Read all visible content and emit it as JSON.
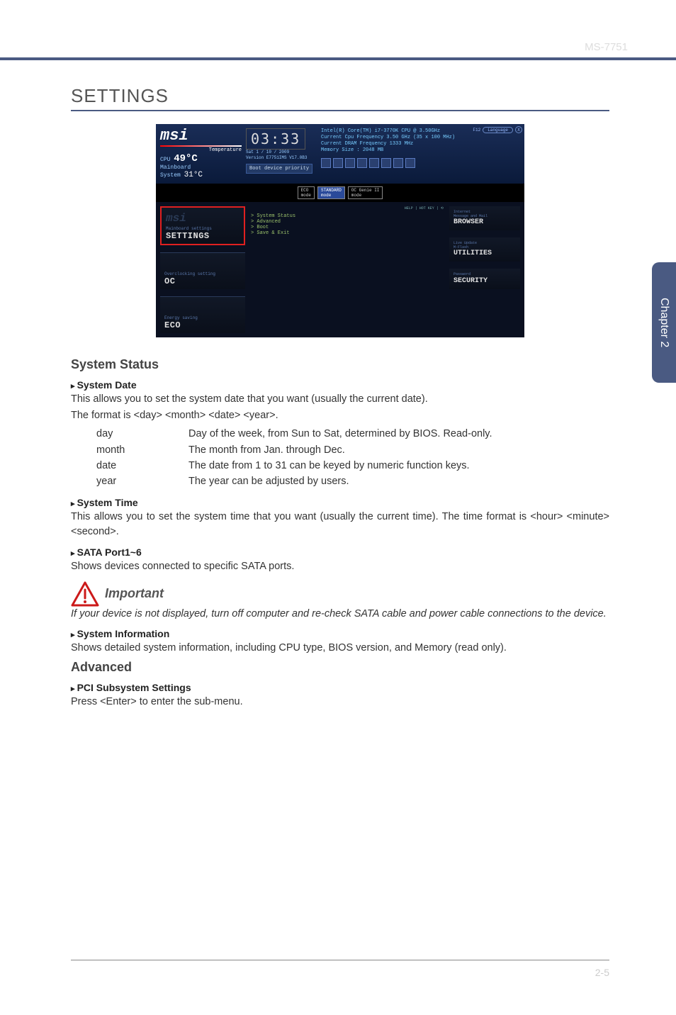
{
  "header": {
    "model": "MS-7751"
  },
  "page": {
    "title": "SETTINGS",
    "page_number": "2-5",
    "side_tab": "Chapter 2"
  },
  "bios": {
    "top_right": {
      "f12": "F12",
      "language": "Language",
      "close": "X"
    },
    "logo": "msi",
    "temperature_label": "Temperature",
    "cpu_label": "CPU",
    "cpu_temp": "49°C",
    "mb_label": "Mainboard\nSystem",
    "mb_temp": "31°C",
    "clock": "03:33",
    "date_line": "Sat  1 / 10 / 2009",
    "version_line": "Version E7751IMS V17.0B3",
    "boot_btn": "Boot device priority",
    "cpu_info_l1": "Intel(R) Core(TM) i7-3770K CPU @ 3.50GHz",
    "cpu_info_l2": "Current Cpu Frequency 3.50 GHz (35 x 100 MHz)",
    "cpu_info_l3": "Current DRAM Frequency 1333 MHz",
    "cpu_info_l4": "Memory Size : 2048 MB",
    "modes": {
      "eco": "ECO\nmode",
      "standard": "STANDARD\nmode",
      "genie": "OC Genie II\nmode"
    },
    "help_hotkey": "HELP  |  HOT KEY  |  ⟲",
    "left_items": [
      {
        "logo": "msi",
        "sub": "Mainboard settings",
        "label": "SETTINGS",
        "selected": true
      },
      {
        "sub": "Overclocking setting",
        "label": "OC"
      },
      {
        "sub": "Energy saving",
        "label": "ECO"
      }
    ],
    "menu_items": [
      "System Status",
      "Advanced",
      "Boot",
      "Save & Exit"
    ],
    "right_items": [
      {
        "sub": "Internet\nMessage and Mail",
        "label": "BROWSER"
      },
      {
        "sub": "Live Update\nM-Flash",
        "label": "UTILITIES"
      },
      {
        "sub": "Password",
        "label": "SECURITY"
      }
    ]
  },
  "sections": {
    "system_status": {
      "title": "System Status",
      "system_date": {
        "heading": "System Date",
        "desc": "This allows you to set the system date that you want (usually the current date).",
        "format_line": "The format is <day> <month> <date> <year>.",
        "rows": [
          {
            "term": "day",
            "def": "Day of the week, from Sun to Sat, determined by BIOS. Read-only."
          },
          {
            "term": "month",
            "def": "The month from Jan. through Dec."
          },
          {
            "term": "date",
            "def": "The date from 1 to 31 can be keyed by numeric function keys."
          },
          {
            "term": "year",
            "def": "The year can be adjusted by users."
          }
        ]
      },
      "system_time": {
        "heading": "System Time",
        "desc": "This allows you to set the system time that you want (usually the current time). The time format is <hour> <minute> <second>."
      },
      "sata": {
        "heading": "SATA Port1~6",
        "desc": "Shows devices connected to specific SATA ports."
      },
      "important": {
        "label": "Important",
        "note": "If your device is not displayed, turn off computer and re-check SATA cable and power cable connections to the device."
      },
      "system_info": {
        "heading": "System Information",
        "desc": "Shows detailed system information, including CPU type, BIOS version, and Memory (read only)."
      }
    },
    "advanced": {
      "title": "Advanced",
      "pci": {
        "heading": "PCI Subsystem Settings",
        "desc": "Press <Enter> to enter the sub-menu."
      }
    }
  }
}
